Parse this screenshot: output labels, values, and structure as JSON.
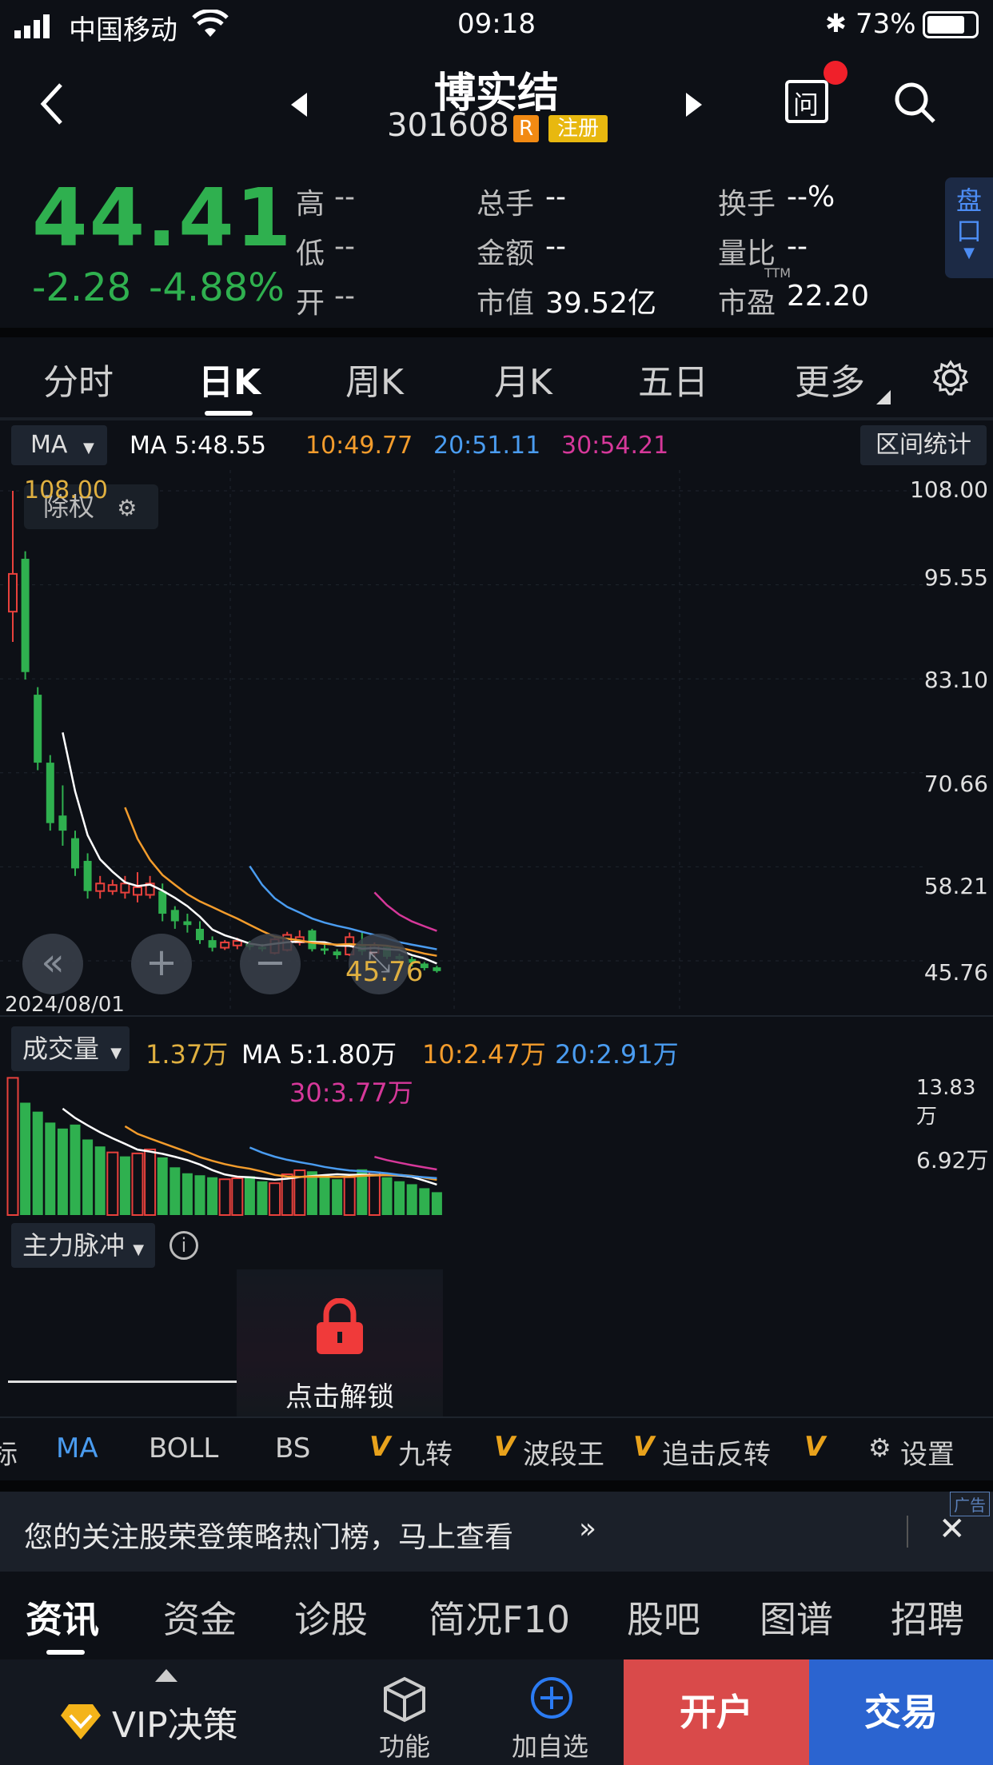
{
  "status_bar": {
    "carrier": "中国移动",
    "time": "09:18",
    "battery": "73%"
  },
  "header": {
    "name": "博实结",
    "code": "301608",
    "badge_r": "R",
    "badge_reg": "注册"
  },
  "quote": {
    "price": "44.41",
    "change": "-2.28",
    "change_pct": "-4.88%",
    "fields": [
      {
        "label": "高",
        "value": "--"
      },
      {
        "label": "低",
        "value": "--"
      },
      {
        "label": "开",
        "value": "--"
      },
      {
        "label": "总手",
        "value": "--"
      },
      {
        "label": "金额",
        "value": "--"
      },
      {
        "label": "市值",
        "value": "39.52亿"
      },
      {
        "label": "换手",
        "value": "--%"
      },
      {
        "label": "量比",
        "value": "--"
      },
      {
        "label": "市盈",
        "value": "22.20"
      }
    ],
    "ttm": "TTM",
    "pankou": "盘口"
  },
  "period_tabs": [
    "分时",
    "日K",
    "周K",
    "月K",
    "五日",
    "更多"
  ],
  "ma_legend": {
    "selector": "MA",
    "ma5": "MA 5:48.55",
    "ma10": "10:49.77",
    "ma20": "20:51.11",
    "ma30": "30:54.21",
    "range_stat": "区间统计",
    "colors": {
      "ma5": "#ffffff",
      "ma10": "#f39c2c",
      "ma20": "#4a9cf0",
      "ma30": "#d6389a"
    }
  },
  "kchart": {
    "chuquan": "除权",
    "date_label": "2024/08/01",
    "max_label": "108.00",
    "last_label": "45.76",
    "y_ticks": [
      "108.00",
      "95.55",
      "83.10",
      "70.66",
      "58.21",
      "45.76"
    ]
  },
  "chart_data": {
    "type": "candlestick",
    "ylim": [
      45.76,
      108.0
    ],
    "up_color": "#e8413c",
    "down_color": "#2fb04f",
    "candles": [
      {
        "o": 92,
        "c": 97,
        "h": 108,
        "l": 88
      },
      {
        "o": 99,
        "c": 84,
        "h": 100,
        "l": 83
      },
      {
        "o": 81,
        "c": 72,
        "h": 82,
        "l": 71
      },
      {
        "o": 72,
        "c": 64,
        "h": 73,
        "l": 63
      },
      {
        "o": 65,
        "c": 63,
        "h": 69,
        "l": 61
      },
      {
        "o": 62,
        "c": 58,
        "h": 63,
        "l": 57
      },
      {
        "o": 59,
        "c": 55,
        "h": 60,
        "l": 54
      },
      {
        "o": 55,
        "c": 56,
        "h": 57,
        "l": 54
      },
      {
        "o": 55,
        "c": 55.8,
        "h": 56.5,
        "l": 54.5
      },
      {
        "o": 54.8,
        "c": 56,
        "h": 57,
        "l": 54
      },
      {
        "o": 54.5,
        "c": 55.5,
        "h": 57.5,
        "l": 53.5
      },
      {
        "o": 54.5,
        "c": 56,
        "h": 57,
        "l": 54
      },
      {
        "o": 55,
        "c": 52,
        "h": 56,
        "l": 51
      },
      {
        "o": 52.5,
        "c": 51,
        "h": 53,
        "l": 50
      },
      {
        "o": 51,
        "c": 50.5,
        "h": 52,
        "l": 49.5
      },
      {
        "o": 50,
        "c": 48.5,
        "h": 51,
        "l": 48
      },
      {
        "o": 48.5,
        "c": 47.5,
        "h": 49,
        "l": 47
      },
      {
        "o": 47.5,
        "c": 48.2,
        "h": 48.5,
        "l": 47.2
      },
      {
        "o": 47.8,
        "c": 48.4,
        "h": 48.8,
        "l": 47.3
      },
      {
        "o": 48,
        "c": 47.6,
        "h": 48.4,
        "l": 47.2
      },
      {
        "o": 47.6,
        "c": 47.3,
        "h": 48,
        "l": 47
      },
      {
        "o": 46.8,
        "c": 48.6,
        "h": 49,
        "l": 46.6
      },
      {
        "o": 47.2,
        "c": 49.2,
        "h": 49.6,
        "l": 47
      },
      {
        "o": 48.2,
        "c": 48.9,
        "h": 49.8,
        "l": 47.8
      },
      {
        "o": 49.8,
        "c": 47.3,
        "h": 50,
        "l": 47
      },
      {
        "o": 47.4,
        "c": 47.1,
        "h": 48,
        "l": 46.6
      },
      {
        "o": 47,
        "c": 46.5,
        "h": 47.3,
        "l": 46
      },
      {
        "o": 46.6,
        "c": 48.9,
        "h": 49.5,
        "l": 46.4
      },
      {
        "o": 48,
        "c": 47,
        "h": 49.5,
        "l": 46.5
      },
      {
        "o": 46.8,
        "c": 47.8,
        "h": 48.2,
        "l": 46.3
      },
      {
        "o": 47.6,
        "c": 46.3,
        "h": 47.8,
        "l": 46
      },
      {
        "o": 46.4,
        "c": 46,
        "h": 46.7,
        "l": 45.6
      },
      {
        "o": 46,
        "c": 45.5,
        "h": 46.3,
        "l": 45
      },
      {
        "o": 45.4,
        "c": 44.8,
        "h": 45.6,
        "l": 44.5
      },
      {
        "o": 44.9,
        "c": 44.4,
        "h": 45.1,
        "l": 44.2
      }
    ]
  },
  "volume": {
    "selector": "成交量",
    "vol": "1.37万",
    "ma5": "MA 5:1.80万",
    "ma10": "10:2.47万",
    "ma20": "20:2.91万",
    "ma30": "30:3.77万",
    "y_ticks": [
      "13.83万",
      "6.92万"
    ],
    "bars": [
      13.8,
      11.3,
      10.4,
      9.3,
      8.7,
      9.1,
      7.6,
      6.9,
      6.3,
      5.9,
      6.2,
      6.6,
      5.8,
      4.8,
      4.2,
      4.0,
      3.8,
      3.6,
      3.7,
      3.9,
      3.4,
      3.2,
      4.1,
      4.5,
      4.4,
      3.9,
      3.6,
      3.8,
      4.6,
      4.3,
      3.8,
      3.4,
      3.1,
      2.7,
      2.3
    ],
    "bar_up": [
      true,
      false,
      false,
      false,
      false,
      false,
      false,
      false,
      true,
      false,
      true,
      true,
      false,
      false,
      false,
      false,
      false,
      true,
      true,
      false,
      false,
      true,
      true,
      true,
      false,
      false,
      false,
      true,
      false,
      true,
      false,
      false,
      false,
      false,
      false
    ]
  },
  "pulse": {
    "selector": "主力脉冲",
    "unlock": "点击解锁"
  },
  "indicator_bar": [
    "标",
    "MA",
    "BOLL",
    "BS",
    "九转",
    "波段王",
    "追击反转",
    "设置"
  ],
  "promo": {
    "text": "您的关注股荣登策略热门榜，马上查看",
    "ad": "广告"
  },
  "info_tabs": [
    "资讯",
    "资金",
    "诊股",
    "简况F10",
    "股吧",
    "图谱",
    "招聘"
  ],
  "bottom_bar": {
    "vip": "VIP决策",
    "func": "功能",
    "add": "加自选",
    "kaihu": "开户",
    "jiaoyi": "交易"
  }
}
